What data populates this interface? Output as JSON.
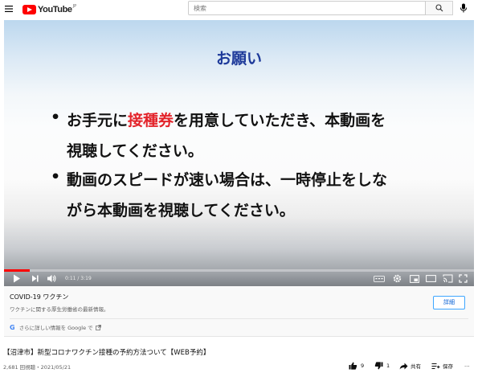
{
  "header": {
    "logo_text": "YouTube",
    "logo_region": "JP",
    "search_placeholder": "検索"
  },
  "video": {
    "slide_title": "お願い",
    "bullet_glyph": "•",
    "bullet1_line1_a": "お手元に",
    "bullet1_line1_red": "接種券",
    "bullet1_line1_b": "を用意していただき、本動画を",
    "bullet1_line2": "視聴してください。",
    "bullet2_line1": "動画のスピードが速い場合は、一時停止をしな",
    "bullet2_line2": "がら本動画を視聴してください。",
    "time_display": "0:11 / 3:19",
    "progress_fraction": 0.055
  },
  "covid_card": {
    "title": "COVID-19 ワクチン",
    "description": "ワクチンに関する厚生労働省の最新情報。",
    "google_link": "さらに詳しい情報を Google で",
    "detail_button": "詳細"
  },
  "meta": {
    "title": "【沼津市】新型コロナワクチン接種の予約方法ついて【WEB予約】",
    "views_date": "2,681 回視聴・2021/05/21",
    "likes": "9",
    "dislikes": "1",
    "share_label": "共有",
    "save_label": "保存",
    "more_label": "…"
  },
  "colors": {
    "brand_red": "#ff0000",
    "slide_title_blue": "#1e3a9a",
    "highlight_red": "#e3242b",
    "link_blue": "#065fd4"
  },
  "icons": [
    "menu-icon",
    "youtube-logo-icon",
    "search-icon",
    "mic-icon",
    "play-icon",
    "next-icon",
    "volume-icon",
    "subtitles-icon",
    "settings-icon",
    "miniplayer-icon",
    "theater-icon",
    "cast-icon",
    "fullscreen-icon",
    "google-icon",
    "external-link-icon",
    "like-icon",
    "dislike-icon",
    "share-icon",
    "save-icon"
  ]
}
